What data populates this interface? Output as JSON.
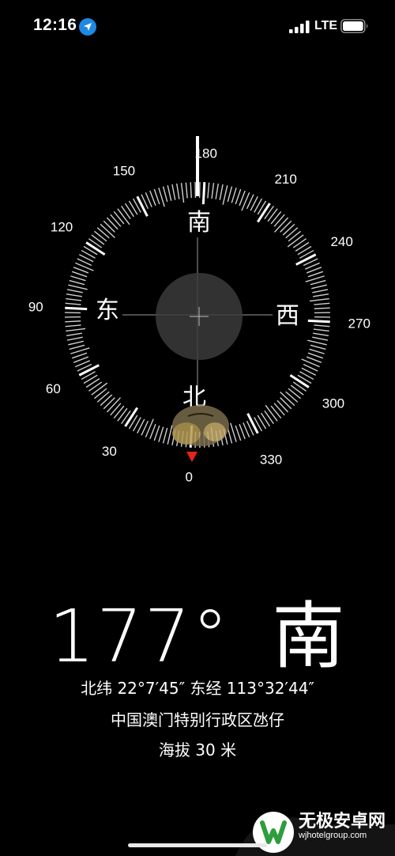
{
  "status_bar": {
    "time": "12:16",
    "network": "LTE",
    "icons": [
      "location-arrow-icon",
      "signal-bars-icon",
      "battery-icon"
    ]
  },
  "compass": {
    "degree_labels": [
      "0",
      "30",
      "60",
      "90",
      "120",
      "150",
      "180",
      "210",
      "240",
      "270",
      "300",
      "330"
    ],
    "cardinal": {
      "north": "北",
      "east": "东",
      "south": "南",
      "west": "西"
    },
    "heading_deg": 177,
    "accent_color": "#e8231a"
  },
  "readout": {
    "heading": "177°",
    "direction": "南",
    "coordinates": "北纬 22°7′45″  东经 113°32′44″",
    "place": "中国澳门特别行政区氹仔",
    "altitude": "海拔 30 米"
  },
  "watermark": {
    "title": "无极安卓网",
    "url": "wjhotelgroup.com"
  }
}
